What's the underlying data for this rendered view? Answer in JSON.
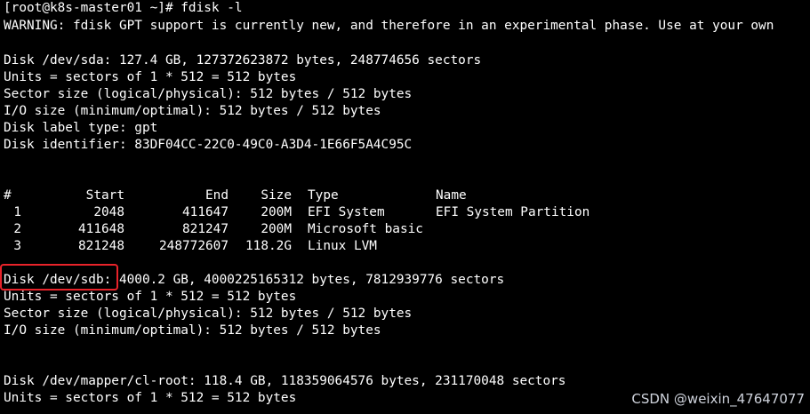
{
  "terminal": {
    "prompt_line": "[root@k8s-master01 ~]# fdisk -l",
    "warning_line": "WARNING: fdisk GPT support is currently new, and therefore in an experimental phase. Use at your own",
    "sda": {
      "disk_line": "Disk /dev/sda: 127.4 GB, 127372623872 bytes, 248774656 sectors",
      "units_line": "Units = sectors of 1 * 512 = 512 bytes",
      "sector_size_line": "Sector size (logical/physical): 512 bytes / 512 bytes",
      "io_size_line": "I/O size (minimum/optimal): 512 bytes / 512 bytes",
      "label_type_line": "Disk label type: gpt",
      "identifier_line": "Disk identifier: 83DF04CC-22C0-49C0-A3D4-1E66F5A4C95C"
    },
    "partition_table": {
      "headers": {
        "num": "#",
        "start": "Start",
        "end": "End",
        "size": "Size",
        "type": "Type",
        "name": "Name"
      },
      "rows": [
        {
          "num": "1",
          "start": "2048",
          "end": "411647",
          "size": "200M",
          "type": "EFI System",
          "name": "EFI System Partition"
        },
        {
          "num": "2",
          "start": "411648",
          "end": "821247",
          "size": "200M",
          "type": "Microsoft basic",
          "name": ""
        },
        {
          "num": "3",
          "start": "821248",
          "end": "248772607",
          "size": "118.2G",
          "type": "Linux LVM",
          "name": ""
        }
      ]
    },
    "sdb": {
      "disk_line": "Disk /dev/sdb: 4000.2 GB, 4000225165312 bytes, 7812939776 sectors",
      "units_line": "Units = sectors of 1 * 512 = 512 bytes",
      "sector_size_line": "Sector size (logical/physical): 512 bytes / 512 bytes",
      "io_size_line": "I/O size (minimum/optimal): 512 bytes / 512 bytes"
    },
    "cl_root": {
      "disk_line": "Disk /dev/mapper/cl-root: 118.4 GB, 118359064576 bytes, 231170048 sectors",
      "units_line": "Units = sectors of 1 * 512 = 512 bytes"
    }
  },
  "annotation": {
    "highlight_color": "#e8232a"
  },
  "watermark": {
    "text": "CSDN @weixin_47647077"
  },
  "colors": {
    "background": "#000000",
    "text": "#ffffff"
  }
}
